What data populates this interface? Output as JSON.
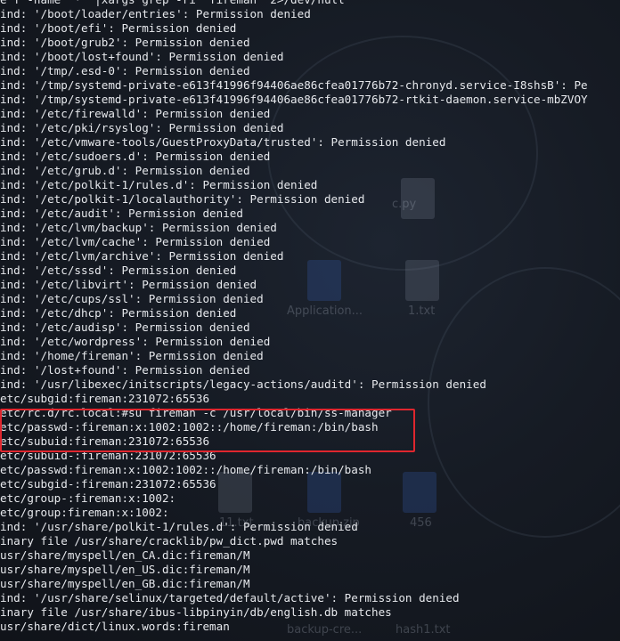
{
  "terminal": {
    "lines": [
      "e f -name \"*\" |xargs grep -ri \"fireman\" 2>/dev/null",
      "ind: '/boot/loader/entries': Permission denied",
      "ind: '/boot/efi': Permission denied",
      "ind: '/boot/grub2': Permission denied",
      "ind: '/boot/lost+found': Permission denied",
      "ind: '/tmp/.esd-0': Permission denied",
      "ind: '/tmp/systemd-private-e613f41996f94406ae86cfea01776b72-chronyd.service-I8shsB': Pe",
      "ind: '/tmp/systemd-private-e613f41996f94406ae86cfea01776b72-rtkit-daemon.service-mbZVOY",
      "ind: '/etc/firewalld': Permission denied",
      "ind: '/etc/pki/rsyslog': Permission denied",
      "ind: '/etc/vmware-tools/GuestProxyData/trusted': Permission denied",
      "ind: '/etc/sudoers.d': Permission denied",
      "ind: '/etc/grub.d': Permission denied",
      "ind: '/etc/polkit-1/rules.d': Permission denied",
      "ind: '/etc/polkit-1/localauthority': Permission denied",
      "ind: '/etc/audit': Permission denied",
      "ind: '/etc/lvm/backup': Permission denied",
      "ind: '/etc/lvm/cache': Permission denied",
      "ind: '/etc/lvm/archive': Permission denied",
      "ind: '/etc/sssd': Permission denied",
      "ind: '/etc/libvirt': Permission denied",
      "ind: '/etc/cups/ssl': Permission denied",
      "ind: '/etc/dhcp': Permission denied",
      "ind: '/etc/audisp': Permission denied",
      "ind: '/etc/wordpress': Permission denied",
      "ind: '/home/fireman': Permission denied",
      "ind: '/lost+found': Permission denied",
      "ind: '/usr/libexec/initscripts/legacy-actions/auditd': Permission denied",
      "etc/subgid:fireman:231072:65536",
      "etc/rc.d/rc.local:#su fireman -c /usr/local/bin/ss-manager",
      "etc/passwd-:fireman:x:1002:1002::/home/fireman:/bin/bash",
      "etc/subuid:fireman:231072:65536",
      "etc/subuid-:fireman:231072:65536",
      "etc/passwd:fireman:x:1002:1002::/home/fireman:/bin/bash",
      "etc/subgid-:fireman:231072:65536",
      "etc/group-:fireman:x:1002:",
      "etc/group:fireman:x:1002:",
      "ind: '/usr/share/polkit-1/rules.d': Permission denied",
      "inary file /usr/share/cracklib/pw_dict.pwd matches",
      "usr/share/myspell/en_CA.dic:fireman/M",
      "usr/share/myspell/en_US.dic:fireman/M",
      "usr/share/myspell/en_GB.dic:fireman/M",
      "ind: '/usr/share/selinux/targeted/default/active': Permission denied",
      "inary file /usr/share/ibus-libpinyin/db/english.db matches",
      "usr/share/dict/linux.words:fireman",
      ""
    ]
  },
  "desktop": {
    "labels": [
      "Application...",
      "1.txt",
      "11.txt",
      "backup.zip",
      "456",
      "backup-cre...",
      "hash1.txt",
      "c.py"
    ]
  }
}
